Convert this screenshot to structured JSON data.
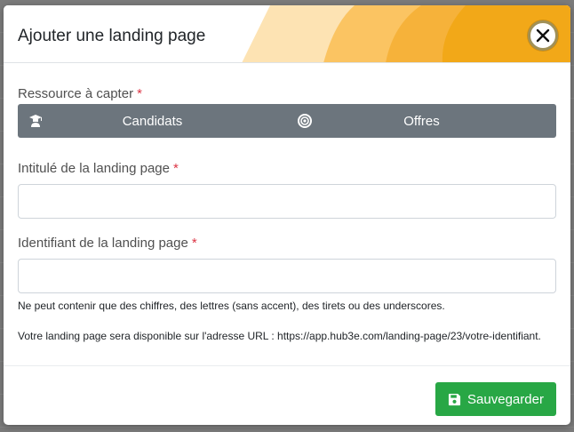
{
  "modal": {
    "title": "Ajouter une landing page",
    "close_icon": "close-icon"
  },
  "form": {
    "resource_label": "Ressource à capter",
    "required_mark": "*",
    "resource_options": [
      {
        "label": "Candidats",
        "icon": "graduate-icon"
      },
      {
        "label": "Offres",
        "icon": "target-icon"
      }
    ],
    "title_label": "Intitulé de la landing page",
    "title_value": "",
    "identifier_label": "Identifiant de la landing page",
    "identifier_value": "",
    "identifier_help": "Ne peut contenir que des chiffres, des lettres (sans accent), des tirets ou des underscores.",
    "url_help": "Votre landing page sera disponible sur l'adresse URL : https://app.hub3e.com/landing-page/23/votre-identifiant."
  },
  "footer": {
    "save_label": "Sauvegarder",
    "save_icon": "save-icon"
  },
  "colors": {
    "toggle_bg": "#6c757d",
    "save_bg": "#28a745",
    "required": "#dc3545",
    "deco_light": "#fde3b3",
    "deco_mid": "#fbbf53",
    "deco_dark": "#f3a712"
  }
}
